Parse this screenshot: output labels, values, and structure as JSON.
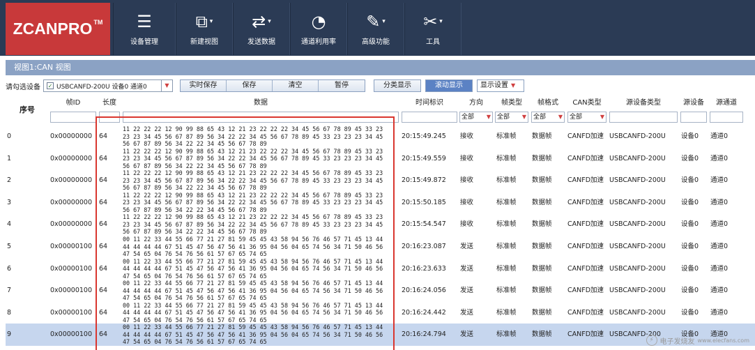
{
  "app": {
    "logo": "ZCANPRO",
    "logo_tm": "TM"
  },
  "toolbar": [
    {
      "label": "设备管理",
      "icon": "device-manager-icon",
      "glyph": "☰",
      "dropdown": false
    },
    {
      "label": "新建视图",
      "icon": "new-view-icon",
      "glyph": "⧉",
      "dropdown": true
    },
    {
      "label": "发送数据",
      "icon": "send-data-icon",
      "glyph": "⇄",
      "dropdown": true
    },
    {
      "label": "通道利用率",
      "icon": "channel-usage-icon",
      "glyph": "◔",
      "dropdown": false
    },
    {
      "label": "高级功能",
      "icon": "advanced-icon",
      "glyph": "✎",
      "dropdown": true
    },
    {
      "label": "工具",
      "icon": "tools-icon",
      "glyph": "✂",
      "dropdown": true
    }
  ],
  "view": {
    "title": "视图1:CAN 视图"
  },
  "controls": {
    "select_device_label": "请勾选设备",
    "device_value": "USBCANFD-200U 设备0 通道0",
    "buttons": [
      "实时保存",
      "保存",
      "清空",
      "暂停"
    ],
    "split_display": "分类显示",
    "scroll_display": "滚动显示",
    "display_settings": "显示设置"
  },
  "table": {
    "headers": {
      "seq": "序号",
      "frame_id": "帧ID",
      "length": "长度",
      "data": "数据",
      "timestamp": "时间标识",
      "direction": "方向",
      "frame_type": "帧类型",
      "frame_format": "帧格式",
      "can_type": "CAN类型",
      "src_dev_type": "源设备类型",
      "src_dev": "源设备",
      "src_channel": "源通道"
    },
    "filters": {
      "direction": "全部",
      "frame_type": "全部",
      "frame_format": "全部",
      "can_type": "全部"
    },
    "rows": [
      {
        "seq": "0",
        "id": "0x00000000",
        "len": "64",
        "data": [
          "11 22 22 22 12 90 99 88 65 43 12 21 23 22 22 22 34 45 56 67 78 89 45 33 23",
          "23 23 34 45 56 67 87 89 56 34 22 22 34 45 56 67 78 89 45 33 23 23 23 34 45",
          "56 67 87 89 56 34 22 22 34 45 56 67 78 89"
        ],
        "time": "20:15:49.245",
        "dir": "接收",
        "ftype": "标准帧",
        "fformat": "数据帧",
        "cantype": "CANFD加速",
        "devtype": "USBCANFD-200U",
        "dev": "设备0",
        "ch": "通道0"
      },
      {
        "seq": "1",
        "id": "0x00000000",
        "len": "64",
        "data": [
          "11 22 22 22 12 90 99 88 65 43 12 21 23 22 22 22 34 45 56 67 78 89 45 33 23",
          "23 23 34 45 56 67 87 89 56 34 22 22 34 45 56 67 78 89 45 33 23 23 23 34 45",
          "56 67 87 89 56 34 22 22 34 45 56 67 78 89"
        ],
        "time": "20:15:49.559",
        "dir": "接收",
        "ftype": "标准帧",
        "fformat": "数据帧",
        "cantype": "CANFD加速",
        "devtype": "USBCANFD-200U",
        "dev": "设备0",
        "ch": "通道0"
      },
      {
        "seq": "2",
        "id": "0x00000000",
        "len": "64",
        "data": [
          "11 22 22 22 12 90 99 88 65 43 12 21 23 22 22 22 34 45 56 67 78 89 45 33 23",
          "23 23 34 45 56 67 87 89 56 34 22 22 34 45 56 67 78 89 45 33 23 23 23 34 45",
          "56 67 87 89 56 34 22 22 34 45 56 67 78 89"
        ],
        "time": "20:15:49.872",
        "dir": "接收",
        "ftype": "标准帧",
        "fformat": "数据帧",
        "cantype": "CANFD加速",
        "devtype": "USBCANFD-200U",
        "dev": "设备0",
        "ch": "通道0"
      },
      {
        "seq": "3",
        "id": "0x00000000",
        "len": "64",
        "data": [
          "11 22 22 22 12 90 99 88 65 43 12 21 23 22 22 22 34 45 56 67 78 89 45 33 23",
          "23 23 34 45 56 67 87 89 56 34 22 22 34 45 56 67 78 89 45 33 23 23 23 34 45",
          "56 67 87 89 56 34 22 22 34 45 56 67 78 89"
        ],
        "time": "20:15:50.185",
        "dir": "接收",
        "ftype": "标准帧",
        "fformat": "数据帧",
        "cantype": "CANFD加速",
        "devtype": "USBCANFD-200U",
        "dev": "设备0",
        "ch": "通道0"
      },
      {
        "seq": "4",
        "id": "0x00000000",
        "len": "64",
        "data": [
          "11 22 22 22 12 90 99 88 65 43 12 21 23 22 22 22 34 45 56 67 78 89 45 33 23",
          "23 23 34 45 56 67 87 89 56 34 22 22 34 45 56 67 78 89 45 33 23 23 23 34 45",
          "56 67 87 89 56 34 22 22 34 45 56 67 78 89"
        ],
        "time": "20:15:54.547",
        "dir": "接收",
        "ftype": "标准帧",
        "fformat": "数据帧",
        "cantype": "CANFD加速",
        "devtype": "USBCANFD-200U",
        "dev": "设备0",
        "ch": "通道0"
      },
      {
        "seq": "5",
        "id": "0x00000100",
        "len": "64",
        "data": [
          "00 11 22 33 44 55 66 77 21 27 81 59 45 45 43 58 94 56 76 46 57 71 45 13 44",
          "44 44 44 44 67 51 45 47 56 47 56 41 36 95 04 56 04 65 74 56 34 71 50 46 56",
          "47 54 65 04 76 54 76 56 61 57 67 65 74 65"
        ],
        "time": "20:16:23.087",
        "dir": "发送",
        "ftype": "标准帧",
        "fformat": "数据帧",
        "cantype": "CANFD加速",
        "devtype": "USBCANFD-200U",
        "dev": "设备0",
        "ch": "通道0"
      },
      {
        "seq": "6",
        "id": "0x00000100",
        "len": "64",
        "data": [
          "00 11 22 33 44 55 66 77 21 27 81 59 45 45 43 58 94 56 76 46 57 71 45 13 44",
          "44 44 44 44 67 51 45 47 56 47 56 41 36 95 04 56 04 65 74 56 34 71 50 46 56",
          "47 54 65 04 76 54 76 56 61 57 67 65 74 65"
        ],
        "time": "20:16:23.633",
        "dir": "发送",
        "ftype": "标准帧",
        "fformat": "数据帧",
        "cantype": "CANFD加速",
        "devtype": "USBCANFD-200U",
        "dev": "设备0",
        "ch": "通道0"
      },
      {
        "seq": "7",
        "id": "0x00000100",
        "len": "64",
        "data": [
          "00 11 22 33 44 55 66 77 21 27 81 59 45 45 43 58 94 56 76 46 57 71 45 13 44",
          "44 44 44 44 67 51 45 47 56 47 56 41 36 95 04 56 04 65 74 56 34 71 50 46 56",
          "47 54 65 04 76 54 76 56 61 57 67 65 74 65"
        ],
        "time": "20:16:24.056",
        "dir": "发送",
        "ftype": "标准帧",
        "fformat": "数据帧",
        "cantype": "CANFD加速",
        "devtype": "USBCANFD-200U",
        "dev": "设备0",
        "ch": "通道0"
      },
      {
        "seq": "8",
        "id": "0x00000100",
        "len": "64",
        "data": [
          "00 11 22 33 44 55 66 77 21 27 81 59 45 45 43 58 94 56 76 46 57 71 45 13 44",
          "44 44 44 44 67 51 45 47 56 47 56 41 36 95 04 56 04 65 74 56 34 71 50 46 56",
          "47 54 65 04 76 54 76 56 61 57 67 65 74 65"
        ],
        "time": "20:16:24.442",
        "dir": "发送",
        "ftype": "标准帧",
        "fformat": "数据帧",
        "cantype": "CANFD加速",
        "devtype": "USBCANFD-200U",
        "dev": "设备0",
        "ch": "通道0"
      },
      {
        "seq": "9",
        "id": "0x00000100",
        "len": "64",
        "data": [
          "00 11 22 33 44 55 66 77 21 27 81 59 45 45 43 58 94 56 76 46 57 71 45 13 44",
          "44 44 44 44 67 51 45 47 56 47 56 41 36 95 04 56 04 65 74 56 34 71 50 46 56",
          "47 54 65 04 76 54 76 56 61 57 67 65 74 65"
        ],
        "time": "20:16:24.794",
        "dir": "发送",
        "ftype": "标准帧",
        "fformat": "数据帧",
        "cantype": "CANFD加速",
        "devtype": "USBCANFD-200",
        "dev": "设备0",
        "ch": "通道0",
        "selected": true
      }
    ]
  },
  "watermark": {
    "text": "电子发烧友",
    "sub": "www.elecfans.com"
  },
  "colors": {
    "header_bg": "#2b3b55",
    "logo_bg": "#c8393a",
    "viewbar_bg": "#8ba2c4",
    "selected_row": "#c6d6ee",
    "highlight_box": "#d9362f"
  }
}
